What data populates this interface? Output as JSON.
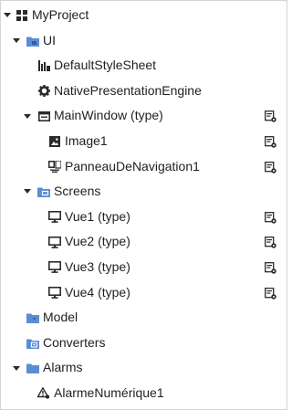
{
  "tree": {
    "root": "MyProject",
    "ui": "UI",
    "style_sheet": "DefaultStyleSheet",
    "presentation_engine": "NativePresentationEngine",
    "main_window": "MainWindow (type)",
    "image1": "Image1",
    "panneau": "PanneauDeNavigation1",
    "screens": "Screens",
    "vue1": "Vue1 (type)",
    "vue2": "Vue2 (type)",
    "vue3": "Vue3 (type)",
    "vue4": "Vue4 (type)",
    "model": "Model",
    "converters": "Converters",
    "alarms": "Alarms",
    "alarme": "AlarmeNumérique1"
  },
  "icons": {
    "root": "project-grid-icon",
    "folder": "folder-icon",
    "style_sheet": "style-sheet-icon",
    "engine": "gear-icon",
    "window": "window-icon",
    "image": "image-icon",
    "navigation": "navigation-panel-icon",
    "screen": "monitor-icon",
    "alarm": "alarm-icon",
    "edit_type": "edit-type-icon"
  },
  "colors": {
    "folder_blue": "#5b8dd6",
    "icon_dark": "#2b2b2b"
  }
}
